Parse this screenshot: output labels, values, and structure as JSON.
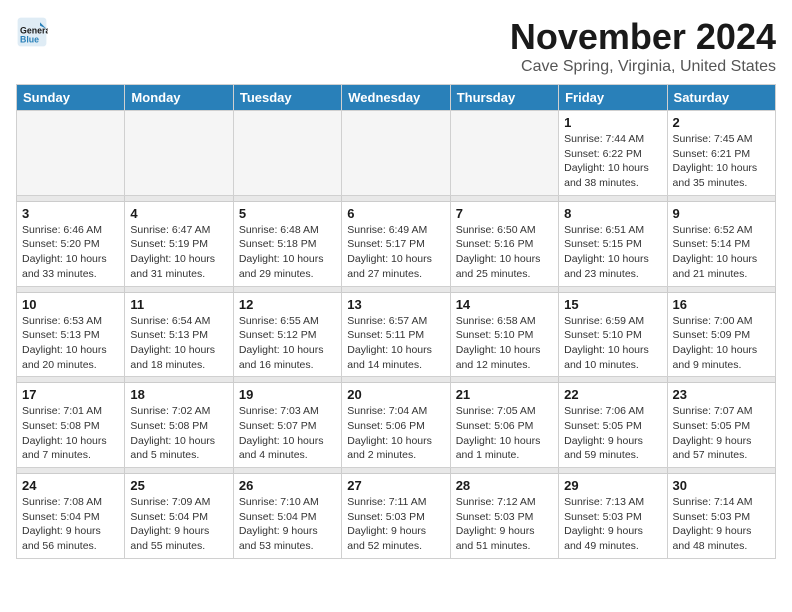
{
  "app": {
    "name": "GeneralBlue",
    "logo_text_line1": "General",
    "logo_text_line2": "Blue"
  },
  "header": {
    "month_year": "November 2024",
    "location": "Cave Spring, Virginia, United States"
  },
  "weekdays": [
    "Sunday",
    "Monday",
    "Tuesday",
    "Wednesday",
    "Thursday",
    "Friday",
    "Saturday"
  ],
  "weeks": [
    {
      "days": [
        {
          "num": "",
          "detail": ""
        },
        {
          "num": "",
          "detail": ""
        },
        {
          "num": "",
          "detail": ""
        },
        {
          "num": "",
          "detail": ""
        },
        {
          "num": "",
          "detail": ""
        },
        {
          "num": "1",
          "detail": "Sunrise: 7:44 AM\nSunset: 6:22 PM\nDaylight: 10 hours\nand 38 minutes."
        },
        {
          "num": "2",
          "detail": "Sunrise: 7:45 AM\nSunset: 6:21 PM\nDaylight: 10 hours\nand 35 minutes."
        }
      ]
    },
    {
      "days": [
        {
          "num": "3",
          "detail": "Sunrise: 6:46 AM\nSunset: 5:20 PM\nDaylight: 10 hours\nand 33 minutes."
        },
        {
          "num": "4",
          "detail": "Sunrise: 6:47 AM\nSunset: 5:19 PM\nDaylight: 10 hours\nand 31 minutes."
        },
        {
          "num": "5",
          "detail": "Sunrise: 6:48 AM\nSunset: 5:18 PM\nDaylight: 10 hours\nand 29 minutes."
        },
        {
          "num": "6",
          "detail": "Sunrise: 6:49 AM\nSunset: 5:17 PM\nDaylight: 10 hours\nand 27 minutes."
        },
        {
          "num": "7",
          "detail": "Sunrise: 6:50 AM\nSunset: 5:16 PM\nDaylight: 10 hours\nand 25 minutes."
        },
        {
          "num": "8",
          "detail": "Sunrise: 6:51 AM\nSunset: 5:15 PM\nDaylight: 10 hours\nand 23 minutes."
        },
        {
          "num": "9",
          "detail": "Sunrise: 6:52 AM\nSunset: 5:14 PM\nDaylight: 10 hours\nand 21 minutes."
        }
      ]
    },
    {
      "days": [
        {
          "num": "10",
          "detail": "Sunrise: 6:53 AM\nSunset: 5:13 PM\nDaylight: 10 hours\nand 20 minutes."
        },
        {
          "num": "11",
          "detail": "Sunrise: 6:54 AM\nSunset: 5:13 PM\nDaylight: 10 hours\nand 18 minutes."
        },
        {
          "num": "12",
          "detail": "Sunrise: 6:55 AM\nSunset: 5:12 PM\nDaylight: 10 hours\nand 16 minutes."
        },
        {
          "num": "13",
          "detail": "Sunrise: 6:57 AM\nSunset: 5:11 PM\nDaylight: 10 hours\nand 14 minutes."
        },
        {
          "num": "14",
          "detail": "Sunrise: 6:58 AM\nSunset: 5:10 PM\nDaylight: 10 hours\nand 12 minutes."
        },
        {
          "num": "15",
          "detail": "Sunrise: 6:59 AM\nSunset: 5:10 PM\nDaylight: 10 hours\nand 10 minutes."
        },
        {
          "num": "16",
          "detail": "Sunrise: 7:00 AM\nSunset: 5:09 PM\nDaylight: 10 hours\nand 9 minutes."
        }
      ]
    },
    {
      "days": [
        {
          "num": "17",
          "detail": "Sunrise: 7:01 AM\nSunset: 5:08 PM\nDaylight: 10 hours\nand 7 minutes."
        },
        {
          "num": "18",
          "detail": "Sunrise: 7:02 AM\nSunset: 5:08 PM\nDaylight: 10 hours\nand 5 minutes."
        },
        {
          "num": "19",
          "detail": "Sunrise: 7:03 AM\nSunset: 5:07 PM\nDaylight: 10 hours\nand 4 minutes."
        },
        {
          "num": "20",
          "detail": "Sunrise: 7:04 AM\nSunset: 5:06 PM\nDaylight: 10 hours\nand 2 minutes."
        },
        {
          "num": "21",
          "detail": "Sunrise: 7:05 AM\nSunset: 5:06 PM\nDaylight: 10 hours\nand 1 minute."
        },
        {
          "num": "22",
          "detail": "Sunrise: 7:06 AM\nSunset: 5:05 PM\nDaylight: 9 hours\nand 59 minutes."
        },
        {
          "num": "23",
          "detail": "Sunrise: 7:07 AM\nSunset: 5:05 PM\nDaylight: 9 hours\nand 57 minutes."
        }
      ]
    },
    {
      "days": [
        {
          "num": "24",
          "detail": "Sunrise: 7:08 AM\nSunset: 5:04 PM\nDaylight: 9 hours\nand 56 minutes."
        },
        {
          "num": "25",
          "detail": "Sunrise: 7:09 AM\nSunset: 5:04 PM\nDaylight: 9 hours\nand 55 minutes."
        },
        {
          "num": "26",
          "detail": "Sunrise: 7:10 AM\nSunset: 5:04 PM\nDaylight: 9 hours\nand 53 minutes."
        },
        {
          "num": "27",
          "detail": "Sunrise: 7:11 AM\nSunset: 5:03 PM\nDaylight: 9 hours\nand 52 minutes."
        },
        {
          "num": "28",
          "detail": "Sunrise: 7:12 AM\nSunset: 5:03 PM\nDaylight: 9 hours\nand 51 minutes."
        },
        {
          "num": "29",
          "detail": "Sunrise: 7:13 AM\nSunset: 5:03 PM\nDaylight: 9 hours\nand 49 minutes."
        },
        {
          "num": "30",
          "detail": "Sunrise: 7:14 AM\nSunset: 5:03 PM\nDaylight: 9 hours\nand 48 minutes."
        }
      ]
    }
  ]
}
